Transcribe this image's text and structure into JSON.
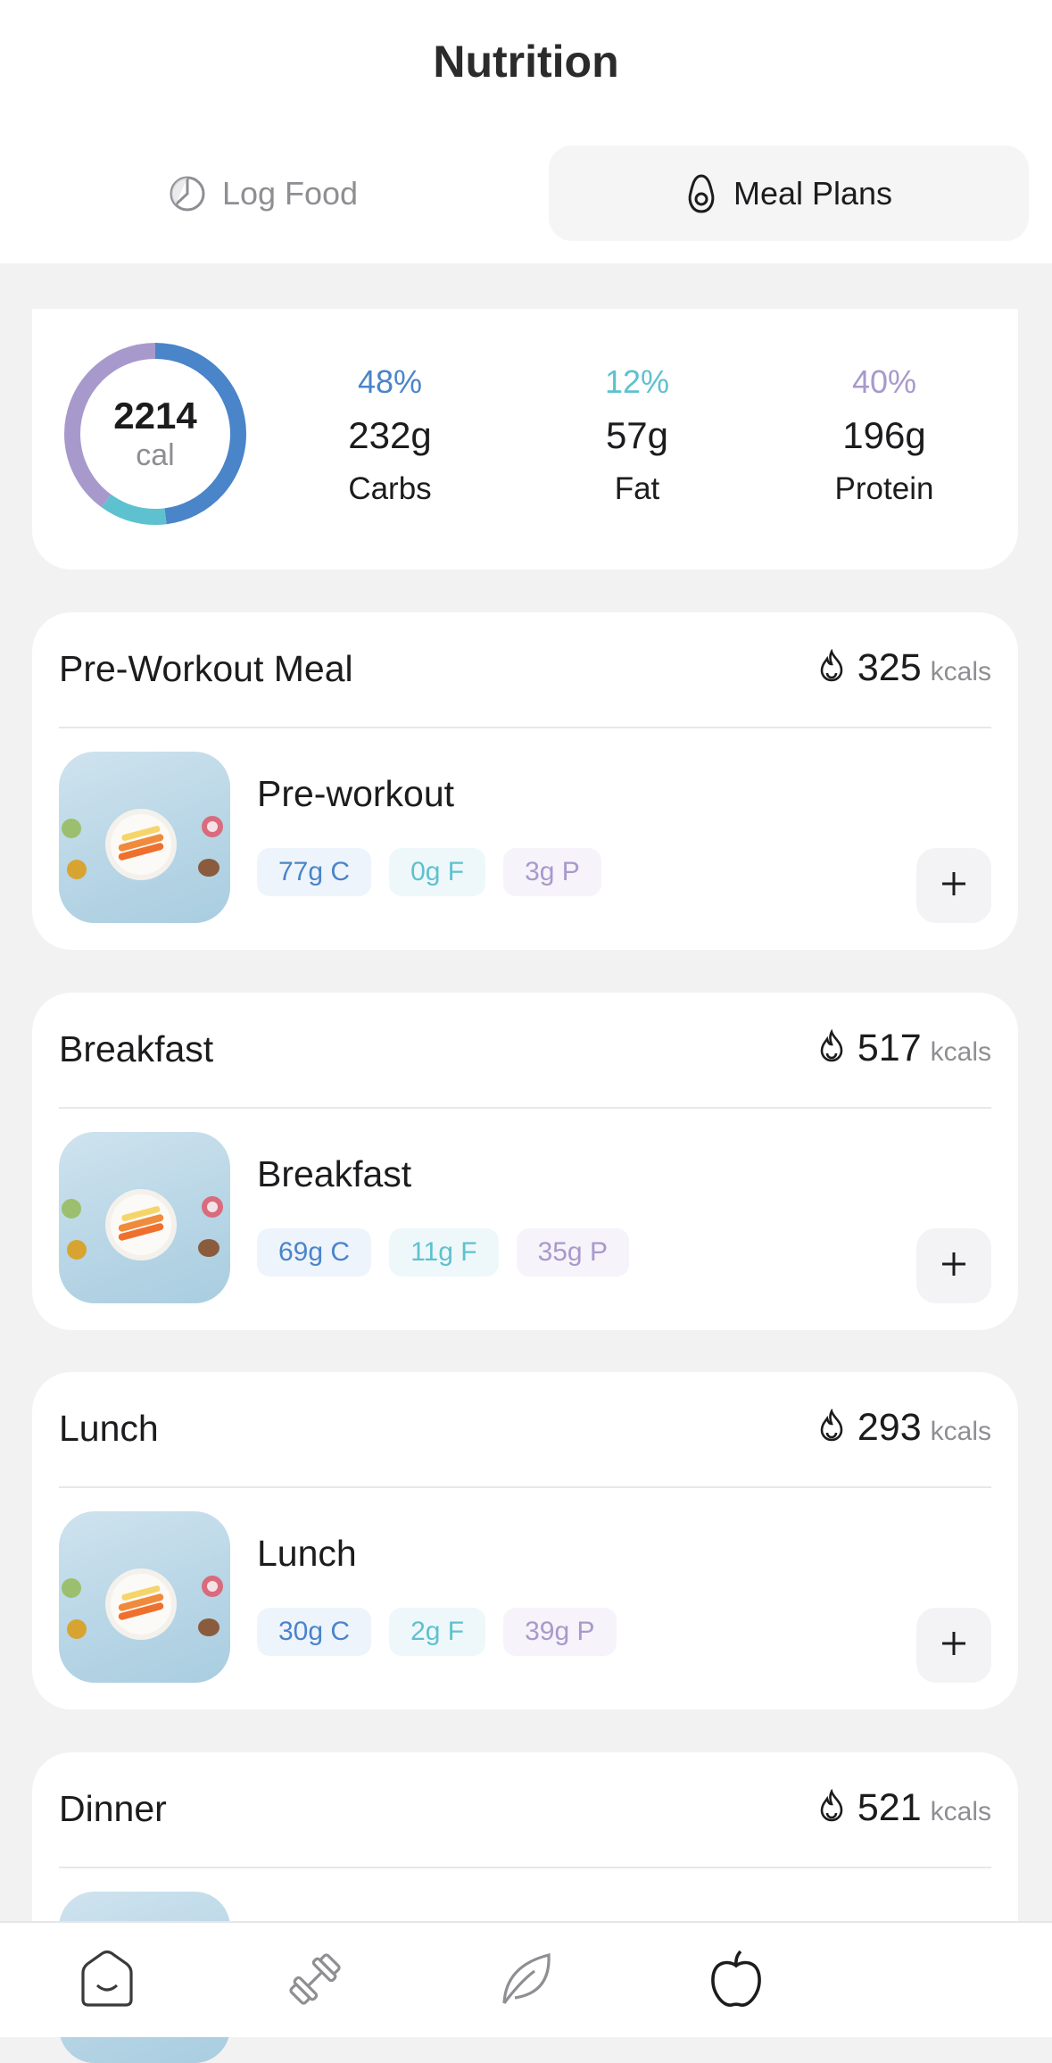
{
  "header": {
    "title": "Nutrition",
    "tabs": [
      {
        "label": "Log Food",
        "icon": "pie-chart-icon",
        "active": false
      },
      {
        "label": "Meal Plans",
        "icon": "avocado-icon",
        "active": true
      }
    ]
  },
  "summary": {
    "calories_value": "2214",
    "calories_unit": "cal",
    "ring_fractions": {
      "carbs": 0.48,
      "fat": 0.12,
      "protein": 0.4
    },
    "macros": [
      {
        "pct": "48%",
        "grams": "232g",
        "label": "Carbs",
        "color": "#4a84c9"
      },
      {
        "pct": "12%",
        "grams": "57g",
        "label": "Fat",
        "color": "#5ec1cf"
      },
      {
        "pct": "40%",
        "grams": "196g",
        "label": "Protein",
        "color": "#a899cc"
      }
    ]
  },
  "meals": [
    {
      "title": "Pre-Workout Meal",
      "kcal": "325",
      "kcal_unit": "kcals",
      "item": "Pre-workout",
      "carbs": "77g C",
      "fat": "0g F",
      "protein": "3g P"
    },
    {
      "title": "Breakfast",
      "kcal": "517",
      "kcal_unit": "kcals",
      "item": "Breakfast",
      "carbs": "69g C",
      "fat": "11g F",
      "protein": "35g P"
    },
    {
      "title": "Lunch",
      "kcal": "293",
      "kcal_unit": "kcals",
      "item": "Lunch",
      "carbs": "30g C",
      "fat": "2g F",
      "protein": "39g P"
    },
    {
      "title": "Dinner",
      "kcal": "521",
      "kcal_unit": "kcals"
    }
  ],
  "tabbar": [
    {
      "name": "home-icon",
      "active": false
    },
    {
      "name": "dumbbell-icon",
      "active": false
    },
    {
      "name": "leaf-icon",
      "active": false
    },
    {
      "name": "apple-icon",
      "active": true
    }
  ],
  "colors": {
    "carbs": "#4a84c9",
    "fat": "#5ec1cf",
    "protein": "#a899cc",
    "background": "#f2f2f2"
  }
}
